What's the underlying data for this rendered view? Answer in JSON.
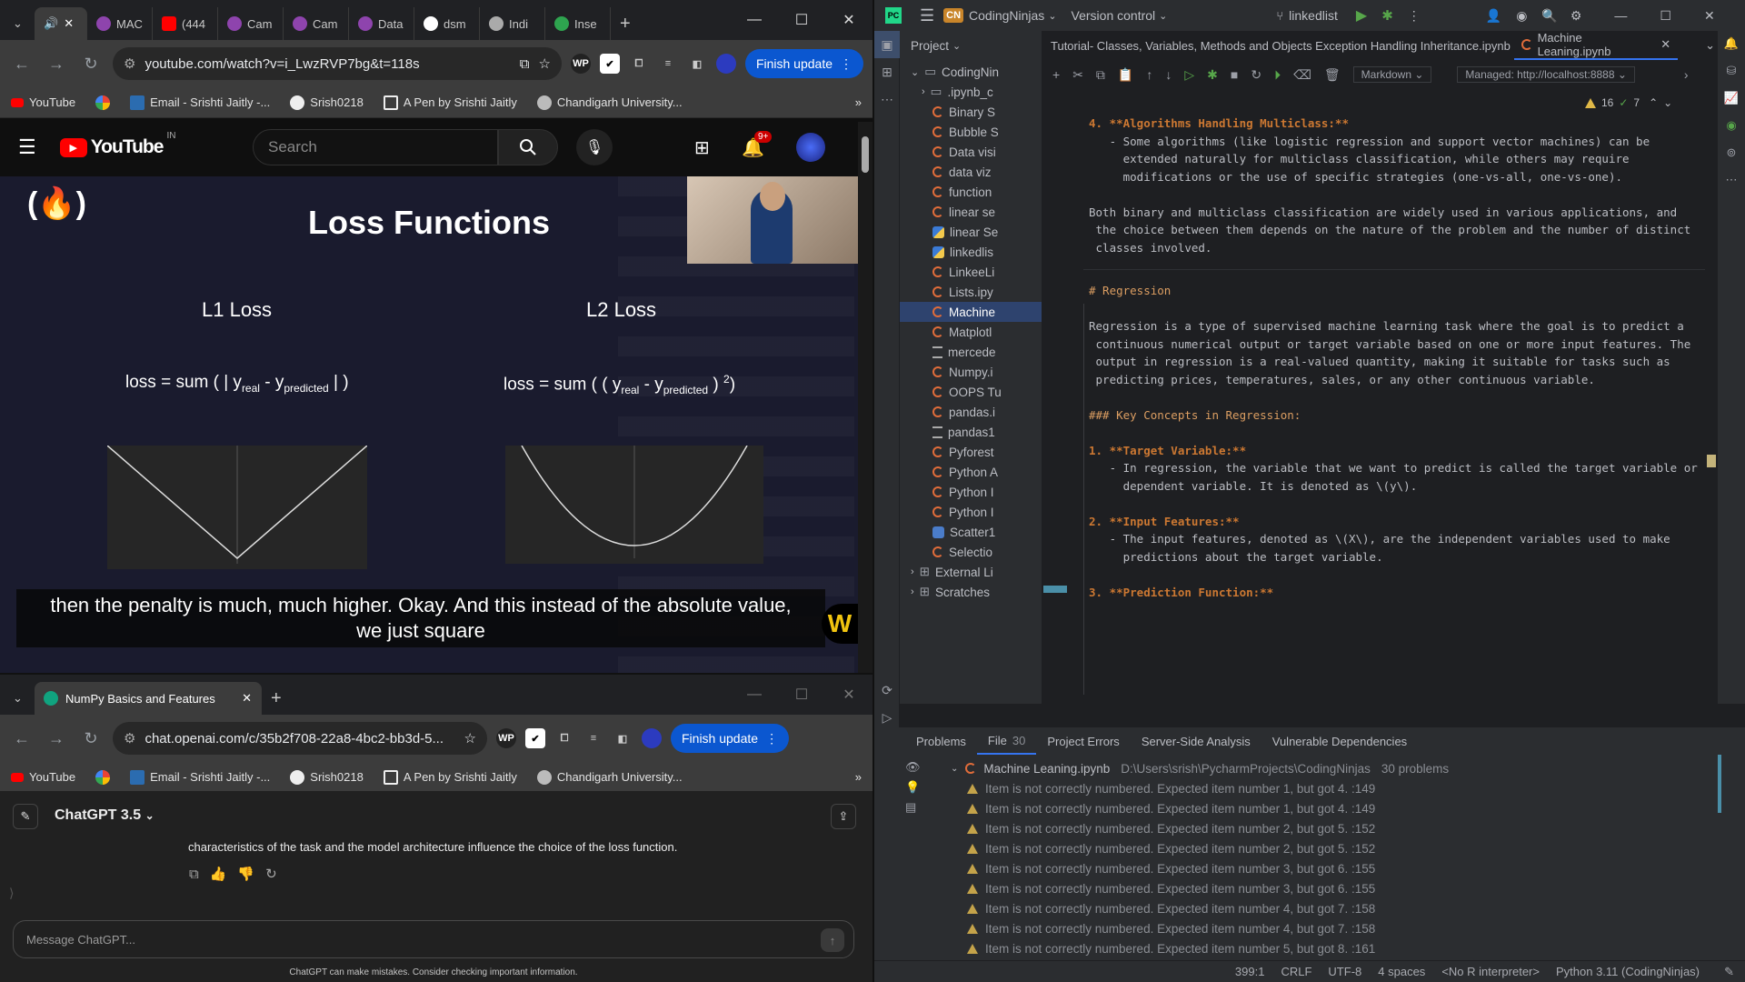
{
  "youtube_window": {
    "tabs": [
      "(",
      "MAC",
      "(444",
      "Cam",
      "Cam",
      "Data",
      "dsm",
      "Indi",
      "Inse"
    ],
    "url": "youtube.com/watch?v=i_LwzRVP7bg&t=118s",
    "finish_update": "Finish update",
    "bookmarks": [
      "YouTube",
      "Email - Srishti Jaitly -...",
      "Srish0218",
      "A Pen by Srishti Jaitly",
      "Chandigarh University..."
    ],
    "yt_logo": "YouTube",
    "yt_region": "IN",
    "search_placeholder": "Search",
    "notif_badge": "9+",
    "slide": {
      "title": "Loss Functions",
      "l1_label": "L1 Loss",
      "l2_label": "L2 Loss",
      "l1_formula_a": "loss = sum ( | y",
      "l1_sub_real": "real",
      "l1_formula_b": " - y",
      "l1_sub_pred": "predicted",
      "l1_formula_c": " | )",
      "l2_formula_a": "loss = sum ( ( y",
      "l2_sub_real": "real",
      "l2_formula_b": " - y",
      "l2_sub_pred": "predicted",
      "l2_formula_c": " ) ",
      "l2_sup": "2",
      "l2_formula_d": ")"
    },
    "caption_line1": "then the penalty is much, much higher. Okay. And this instead of the absolute value,",
    "caption_line2": "we just square",
    "overlay_letter": "W"
  },
  "chatgpt_window": {
    "tab_title": "NumPy Basics and Features",
    "url": "chat.openai.com/c/35b2f708-22a8-4bc2-bb3d-5...",
    "finish_update": "Finish update",
    "bookmarks": [
      "YouTube",
      "Email - Srishti Jaitly -...",
      "Srish0218",
      "A Pen by Srishti Jaitly",
      "Chandigarh University..."
    ],
    "model": "ChatGPT 3.5",
    "message_text": "characteristics of the task and the model architecture influence the choice of the loss function.",
    "input_placeholder": "Message ChatGPT...",
    "disclaimer": "ChatGPT can make mistakes. Consider checking important information."
  },
  "pycharm": {
    "project_badge": "CN",
    "project_name": "CodingNinjas",
    "version_control": "Version control",
    "branch": "linkedlist",
    "project_label": "Project",
    "tabs": [
      "Tutorial- Classes, Variables, Methods and Objects Exception Handling Inheritance.ipynb",
      "Machine Leaning.ipynb"
    ],
    "kernel": "Markdown",
    "managed": "Managed: http://localhost:8888",
    "inspections": {
      "warnings": "16",
      "ok": "7"
    },
    "tree": [
      {
        "label": "CodingNin",
        "type": "folder"
      },
      {
        "label": ".ipynb_c",
        "type": "folder"
      },
      {
        "label": "Binary S",
        "type": "nb"
      },
      {
        "label": "Bubble S",
        "type": "nb"
      },
      {
        "label": "Data visi",
        "type": "nb"
      },
      {
        "label": "data viz",
        "type": "nb"
      },
      {
        "label": "function",
        "type": "nb"
      },
      {
        "label": "linear se",
        "type": "nb"
      },
      {
        "label": "linear Se",
        "type": "py"
      },
      {
        "label": "linkedlis",
        "type": "py"
      },
      {
        "label": "LinkeeLi",
        "type": "nb"
      },
      {
        "label": "Lists.ipy",
        "type": "nb"
      },
      {
        "label": "Machine",
        "type": "nb"
      },
      {
        "label": "Matplotl",
        "type": "nb"
      },
      {
        "label": "mercede",
        "type": "txt"
      },
      {
        "label": "Numpy.i",
        "type": "nb"
      },
      {
        "label": "OOPS Tu",
        "type": "nb"
      },
      {
        "label": "pandas.i",
        "type": "nb"
      },
      {
        "label": "pandas1",
        "type": "txt"
      },
      {
        "label": "Pyforest",
        "type": "nb"
      },
      {
        "label": "Python A",
        "type": "nb"
      },
      {
        "label": "Python I",
        "type": "nb"
      },
      {
        "label": "Python I",
        "type": "nb"
      },
      {
        "label": "Scatter1",
        "type": "img"
      },
      {
        "label": "Selectio",
        "type": "nb"
      },
      {
        "label": "External Li",
        "type": "lib"
      },
      {
        "label": "Scratches",
        "type": "lib"
      }
    ],
    "editor_lines": [
      {
        "t": "4. **Algorithms Handling Multiclass:**",
        "k": "b"
      },
      {
        "t": "   - Some algorithms (like logistic regression and support vector machines) can be",
        "k": "d"
      },
      {
        "t": "     extended naturally for multiclass classification, while others may require",
        "k": "n"
      },
      {
        "t": "     modifications or the use of specific strategies (one-vs-all, one-vs-one).",
        "k": "n"
      },
      {
        "t": "",
        "k": "n"
      },
      {
        "t": "Both binary and multiclass classification are widely used in various applications, and",
        "k": "n"
      },
      {
        "t": " the choice between them depends on the nature of the problem and the number of distinct",
        "k": "n"
      },
      {
        "t": " classes involved.",
        "k": "n"
      }
    ],
    "editor_lines2": [
      {
        "t": "# Regression",
        "k": "h"
      },
      {
        "t": "",
        "k": "n"
      },
      {
        "t": "Regression is a type of supervised machine learning task where the goal is to predict a",
        "k": "n"
      },
      {
        "t": " continuous numerical output or target variable based on one or more input features. The",
        "k": "n"
      },
      {
        "t": " output in regression is a real-valued quantity, making it suitable for tasks such as",
        "k": "n"
      },
      {
        "t": " predicting prices, temperatures, sales, or any other continuous variable.",
        "k": "n"
      },
      {
        "t": "",
        "k": "n"
      },
      {
        "t": "### Key Concepts in Regression:",
        "k": "h"
      },
      {
        "t": "",
        "k": "n"
      },
      {
        "t": "1. **Target Variable:**",
        "k": "b"
      },
      {
        "t": "   - In regression, the variable that we want to predict is called the target variable or",
        "k": "d"
      },
      {
        "t": "     dependent variable. It is denoted as \\(y\\).",
        "k": "n"
      },
      {
        "t": "",
        "k": "n"
      },
      {
        "t": "2. **Input Features:**",
        "k": "b"
      },
      {
        "t": "   - The input features, denoted as \\(X\\), are the independent variables used to make",
        "k": "d"
      },
      {
        "t": "     predictions about the target variable.",
        "k": "n"
      },
      {
        "t": "",
        "k": "n"
      },
      {
        "t": "3. **Prediction Function:**",
        "k": "b"
      }
    ],
    "problem_tabs": [
      "Problems",
      "File",
      "Project Errors",
      "Server-Side Analysis",
      "Vulnerable Dependencies"
    ],
    "file_count": "30",
    "problem_file": "Machine Leaning.ipynb",
    "problem_path": "D:\\Users\\srish\\PycharmProjects\\CodingNinjas",
    "problem_count": "30 problems",
    "problems": [
      "Item is not correctly numbered. Expected item number 1, but got 4. :149",
      "Item is not correctly numbered. Expected item number 1, but got 4. :149",
      "Item is not correctly numbered. Expected item number 2, but got 5. :152",
      "Item is not correctly numbered. Expected item number 2, but got 5. :152",
      "Item is not correctly numbered. Expected item number 3, but got 6. :155",
      "Item is not correctly numbered. Expected item number 3, but got 6. :155",
      "Item is not correctly numbered. Expected item number 4, but got 7. :158",
      "Item is not correctly numbered. Expected item number 4, but got 7. :158",
      "Item is not correctly numbered. Expected item number 5, but got 8. :161"
    ],
    "status": {
      "position": "399:1",
      "line_sep": "CRLF",
      "encoding": "UTF-8",
      "indent": "4 spaces",
      "r_interp": "<No R interpreter>",
      "python": "Python 3.11 (CodingNinjas)"
    }
  }
}
